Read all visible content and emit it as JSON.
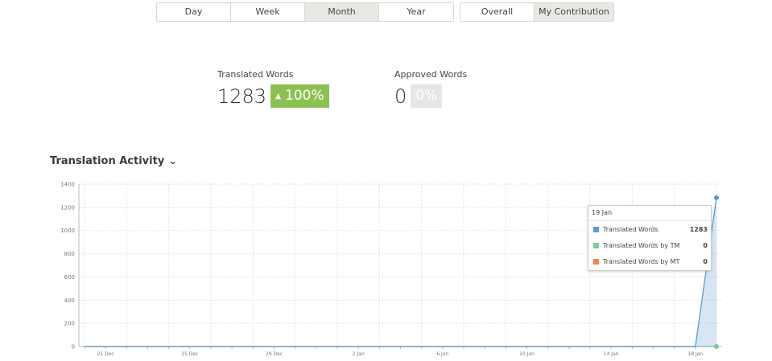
{
  "period_tabs": [
    {
      "label": "Day"
    },
    {
      "label": "Week"
    },
    {
      "label": "Month",
      "active": true
    },
    {
      "label": "Year"
    }
  ],
  "scope_tabs": [
    {
      "label": "Overall"
    },
    {
      "label": "My Contribution",
      "active": true
    }
  ],
  "stats": {
    "translated": {
      "label": "Translated Words",
      "value": "1283",
      "change": "100%",
      "change_color": "#8cc152"
    },
    "approved": {
      "label": "Approved Words",
      "value": "0",
      "change": "0%",
      "change_color": "#e6e6e6"
    }
  },
  "activity": {
    "title": "Translation Activity"
  },
  "chart_data": {
    "type": "area",
    "title": "",
    "xlabel": "",
    "ylabel": "",
    "ylim": [
      0,
      1400
    ],
    "yticks": [
      "0",
      "200",
      "400",
      "600",
      "800",
      "1000",
      "1200",
      "1400"
    ],
    "x_tick_labels": [
      "21 Dec",
      "25 Dec",
      "29 Dec",
      "2 Jan",
      "6 Jan",
      "10 Jan",
      "14 Jan",
      "18 Jan"
    ],
    "x": [
      "20 Dec",
      "21 Dec",
      "22 Dec",
      "23 Dec",
      "24 Dec",
      "25 Dec",
      "26 Dec",
      "27 Dec",
      "28 Dec",
      "29 Dec",
      "30 Dec",
      "31 Dec",
      "1 Jan",
      "2 Jan",
      "3 Jan",
      "4 Jan",
      "5 Jan",
      "6 Jan",
      "7 Jan",
      "8 Jan",
      "9 Jan",
      "10 Jan",
      "11 Jan",
      "12 Jan",
      "13 Jan",
      "14 Jan",
      "15 Jan",
      "16 Jan",
      "17 Jan",
      "18 Jan",
      "19 Jan"
    ],
    "grid": true,
    "series": [
      {
        "name": "Translated Words",
        "color": "#5b9bd5",
        "values": [
          0,
          0,
          0,
          0,
          0,
          0,
          0,
          0,
          0,
          0,
          0,
          0,
          0,
          0,
          0,
          0,
          0,
          0,
          0,
          0,
          0,
          0,
          0,
          0,
          0,
          0,
          0,
          0,
          0,
          0,
          1283
        ]
      },
      {
        "name": "Translated Words by TM",
        "color": "#7ccf9b",
        "values": [
          0,
          0,
          0,
          0,
          0,
          0,
          0,
          0,
          0,
          0,
          0,
          0,
          0,
          0,
          0,
          0,
          0,
          0,
          0,
          0,
          0,
          0,
          0,
          0,
          0,
          0,
          0,
          0,
          0,
          0,
          0
        ]
      },
      {
        "name": "Translated Words by MT",
        "color": "#ed8a4c",
        "values": [
          0,
          0,
          0,
          0,
          0,
          0,
          0,
          0,
          0,
          0,
          0,
          0,
          0,
          0,
          0,
          0,
          0,
          0,
          0,
          0,
          0,
          0,
          0,
          0,
          0,
          0,
          0,
          0,
          0,
          0,
          0
        ]
      }
    ]
  },
  "tooltip": {
    "date": "19 Jan",
    "rows": [
      {
        "name": "Translated Words",
        "value": "1283",
        "color": "#5b9bd5"
      },
      {
        "name": "Translated Words by TM",
        "value": "0",
        "color": "#7ccf9b"
      },
      {
        "name": "Translated Words by MT",
        "value": "0",
        "color": "#ed8a4c"
      }
    ]
  }
}
